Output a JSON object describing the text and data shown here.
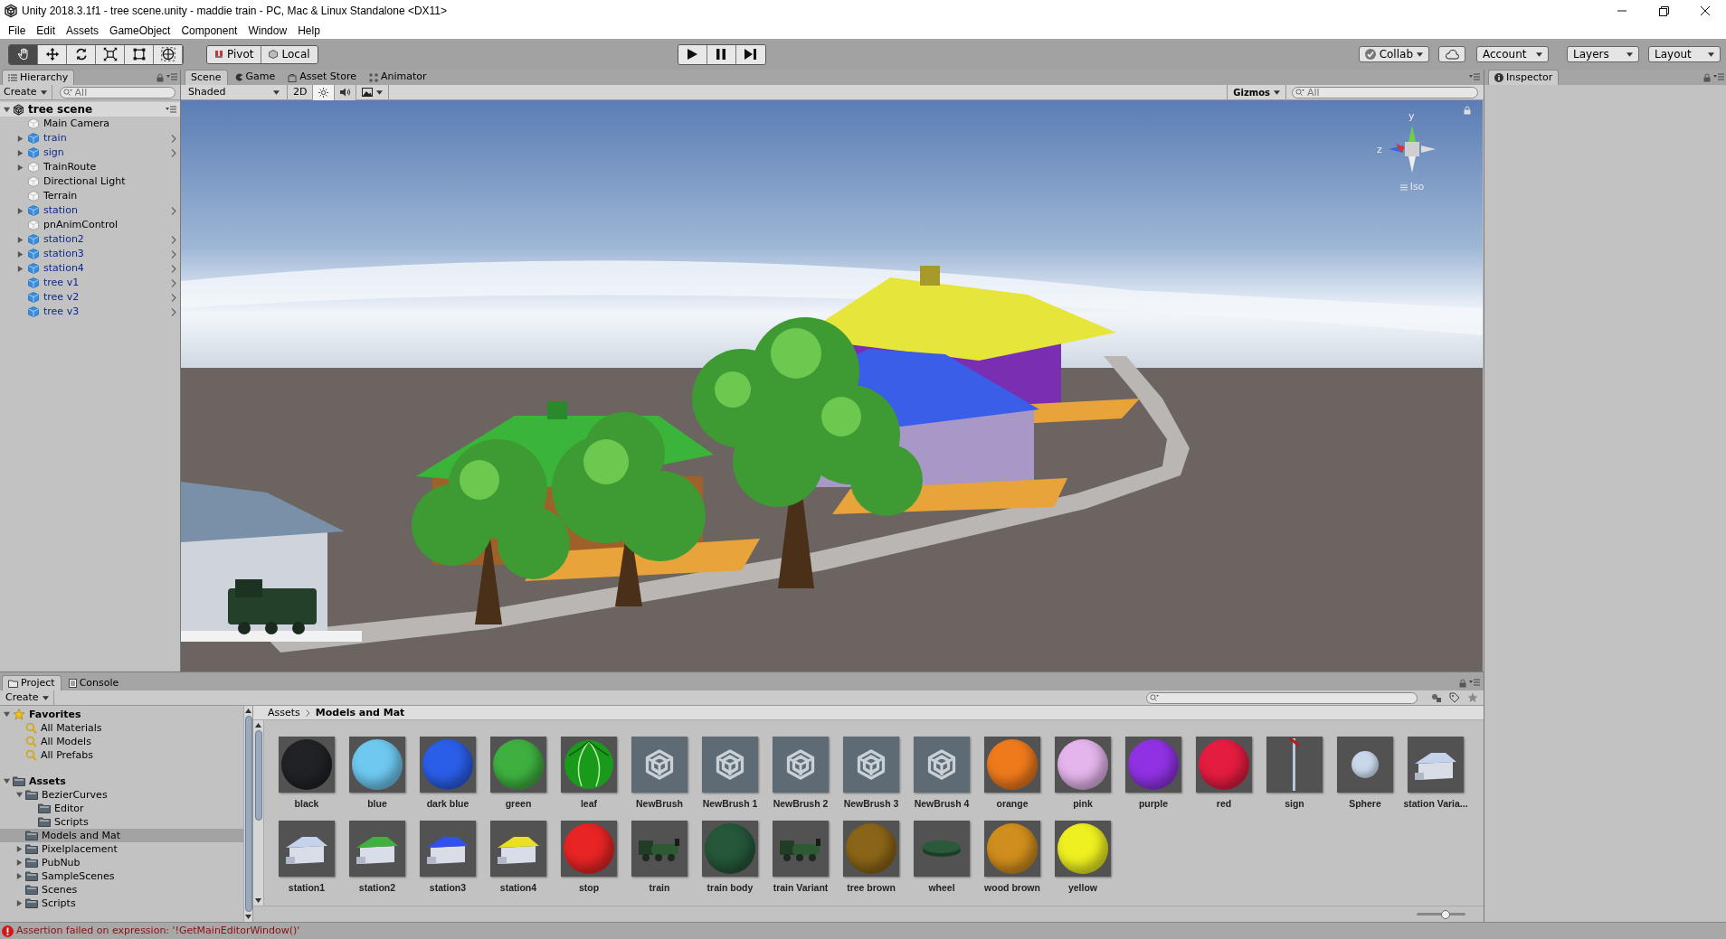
{
  "window": {
    "title": "Unity 2018.3.1f1 - tree scene.unity - maddie train - PC, Mac & Linux Standalone <DX11>"
  },
  "menu": [
    "File",
    "Edit",
    "Assets",
    "GameObject",
    "Component",
    "Window",
    "Help"
  ],
  "toolbar": {
    "tools": [
      {
        "kind": "hand",
        "selected": true
      },
      {
        "kind": "move",
        "selected": false
      },
      {
        "kind": "rotate",
        "selected": false
      },
      {
        "kind": "scale",
        "selected": false
      },
      {
        "kind": "rect",
        "selected": false
      },
      {
        "kind": "transform",
        "selected": false
      }
    ],
    "pivot": "Pivot",
    "local": "Local",
    "collab": "Collab",
    "account": "Account",
    "layers": "Layers",
    "layout": "Layout"
  },
  "hierarchy": {
    "tabs": [
      {
        "label": "Hierarchy",
        "selected": true
      }
    ],
    "create": "Create",
    "search": {
      "placeholder": "All"
    },
    "scene": {
      "name": "tree scene",
      "expanded": true,
      "children": [
        {
          "name": "Main Camera",
          "prefab": false,
          "expandable": false
        },
        {
          "name": "train",
          "prefab": true,
          "expandable": true
        },
        {
          "name": "sign",
          "prefab": true,
          "expandable": true
        },
        {
          "name": "TrainRoute",
          "prefab": false,
          "expandable": true
        },
        {
          "name": "Directional Light",
          "prefab": false,
          "expandable": false
        },
        {
          "name": "Terrain",
          "prefab": false,
          "expandable": false
        },
        {
          "name": "station",
          "prefab": true,
          "expandable": true
        },
        {
          "name": "pnAnimControl",
          "prefab": false,
          "expandable": false
        },
        {
          "name": "station2",
          "prefab": true,
          "expandable": true
        },
        {
          "name": "station3",
          "prefab": true,
          "expandable": true
        },
        {
          "name": "station4",
          "prefab": true,
          "expandable": true
        },
        {
          "name": "tree v1",
          "prefab": true,
          "expandable": false
        },
        {
          "name": "tree v2",
          "prefab": true,
          "expandable": false
        },
        {
          "name": "tree v3",
          "prefab": true,
          "expandable": false
        }
      ]
    }
  },
  "scene_tabs": [
    {
      "label": "Scene",
      "kind": "scene",
      "selected": true
    },
    {
      "label": "Game",
      "kind": "game",
      "selected": false
    },
    {
      "label": "Asset Store",
      "kind": "store",
      "selected": false
    },
    {
      "label": "Animator",
      "kind": "animator",
      "selected": false
    }
  ],
  "scene_toolbar": {
    "shading": "Shaded",
    "mode_2d": "2D",
    "lighting_on": true,
    "audio_on": false,
    "gizmos": "Gizmos",
    "search": {
      "placeholder": "All"
    }
  },
  "gizmo": {
    "axes": [
      "y",
      "z"
    ],
    "projection": "Iso"
  },
  "inspector": {
    "tabs": [
      {
        "label": "Inspector",
        "selected": true
      }
    ]
  },
  "project": {
    "tabs": [
      {
        "label": "Project",
        "kind": "project",
        "selected": true
      },
      {
        "label": "Console",
        "kind": "console",
        "selected": false
      }
    ],
    "create": "Create",
    "tree": [
      {
        "name": "Favorites",
        "kind": "favorites",
        "selected": false,
        "expanded": true,
        "children": [
          {
            "name": "All Materials",
            "kind": "search",
            "selected": false
          },
          {
            "name": "All Models",
            "kind": "search",
            "selected": false
          },
          {
            "name": "All Prefabs",
            "kind": "search",
            "selected": false
          }
        ]
      },
      {
        "name": "Assets",
        "kind": "root",
        "selected": false,
        "expanded": true,
        "children": [
          {
            "name": "BezierCurves",
            "kind": "folder",
            "selected": false,
            "expanded": true,
            "children": [
              {
                "name": "Editor",
                "kind": "folder",
                "selected": false
              },
              {
                "name": "Scripts",
                "kind": "folder",
                "selected": false
              }
            ]
          },
          {
            "name": "Models and Mat",
            "kind": "folder",
            "selected": true
          },
          {
            "name": "Pixelplacement",
            "kind": "folder",
            "selected": false,
            "expanded": false
          },
          {
            "name": "PubNub",
            "kind": "folder",
            "selected": false,
            "expanded": false
          },
          {
            "name": "SampleScenes",
            "kind": "folder",
            "selected": false,
            "expanded": false
          },
          {
            "name": "Scenes",
            "kind": "folder",
            "selected": false
          },
          {
            "name": "Scripts",
            "kind": "folder",
            "selected": false,
            "expanded": false
          }
        ]
      }
    ],
    "breadcrumb": [
      "Assets",
      "Models and Mat"
    ],
    "assets": [
      {
        "name": "black",
        "kind": "sphere",
        "color": "#202226"
      },
      {
        "name": "blue",
        "kind": "sphere",
        "color": "#6ec8f0"
      },
      {
        "name": "dark blue",
        "kind": "sphere",
        "color": "#2a5ee8"
      },
      {
        "name": "green",
        "kind": "sphere",
        "color": "#3fb040"
      },
      {
        "name": "leaf",
        "kind": "leaf"
      },
      {
        "name": "NewBrush",
        "kind": "brush"
      },
      {
        "name": "NewBrush 1",
        "kind": "brush"
      },
      {
        "name": "NewBrush 2",
        "kind": "brush"
      },
      {
        "name": "NewBrush 3",
        "kind": "brush"
      },
      {
        "name": "NewBrush 4",
        "kind": "brush"
      },
      {
        "name": "orange",
        "kind": "sphere",
        "color": "#ee7a1c"
      },
      {
        "name": "pink",
        "kind": "sphere",
        "color": "#e4b4ec"
      },
      {
        "name": "purple",
        "kind": "sphere",
        "color": "#9032e4"
      },
      {
        "name": "red",
        "kind": "sphere",
        "color": "#e41c40"
      },
      {
        "name": "sign",
        "kind": "sign"
      },
      {
        "name": "Sphere",
        "kind": "small-sphere",
        "color": "#c8d8ea"
      },
      {
        "name": "station Varia...",
        "kind": "house",
        "color": "#c4d2ec"
      },
      {
        "name": "station1",
        "kind": "house",
        "color": "#c4d2ec"
      },
      {
        "name": "station2",
        "kind": "house",
        "color": "#40b040"
      },
      {
        "name": "station3",
        "kind": "house",
        "color": "#3050f0"
      },
      {
        "name": "station4",
        "kind": "house",
        "color": "#e8e020"
      },
      {
        "name": "stop",
        "kind": "sphere",
        "color": "#e82424"
      },
      {
        "name": "train",
        "kind": "train"
      },
      {
        "name": "train body",
        "kind": "sphere",
        "color": "#25573a"
      },
      {
        "name": "train Variant",
        "kind": "train"
      },
      {
        "name": "tree brown",
        "kind": "sphere",
        "color": "#8a6418"
      },
      {
        "name": "wheel",
        "kind": "disc",
        "color": "#2a5a3a"
      },
      {
        "name": "wood brown",
        "kind": "sphere",
        "color": "#d08e1c"
      },
      {
        "name": "yellow",
        "kind": "sphere",
        "color": "#eef020"
      }
    ],
    "icon_size_slider": {
      "level": 0.6
    }
  },
  "status_bar": {
    "message": "Assertion failed on expression: '!GetMainEditorWindow()'"
  }
}
